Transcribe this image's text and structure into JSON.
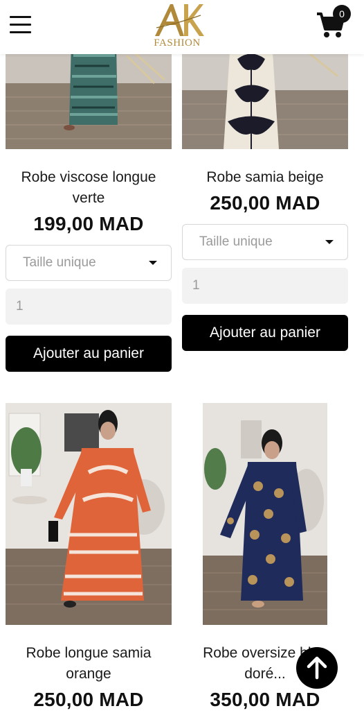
{
  "header": {
    "logo_text": "AK",
    "logo_sub": "FASHION",
    "cart_count": "0",
    "icons": {
      "menu": "hamburger-menu-icon",
      "cart": "shopping-cart-icon",
      "scroll_top": "arrow-up-icon"
    }
  },
  "products": [
    {
      "title": "Robe viscose longue verte",
      "price": "199,00 MAD",
      "size_placeholder": "Taille unique",
      "quantity": "1",
      "add_label": "Ajouter au panier"
    },
    {
      "title": "Robe samia beige",
      "price": "250,00 MAD",
      "size_placeholder": "Taille unique",
      "quantity": "1",
      "add_label": "Ajouter au panier"
    },
    {
      "title": "Robe longue samia orange",
      "price": "250,00 MAD"
    },
    {
      "title": "Robe oversize bleu doré...",
      "price": "350,00 MAD"
    }
  ],
  "colors": {
    "accent": "#000000",
    "logo_gold": "#b08a3a",
    "dress_orange": "#e0643a",
    "dress_navy": "#1f2b5a"
  }
}
